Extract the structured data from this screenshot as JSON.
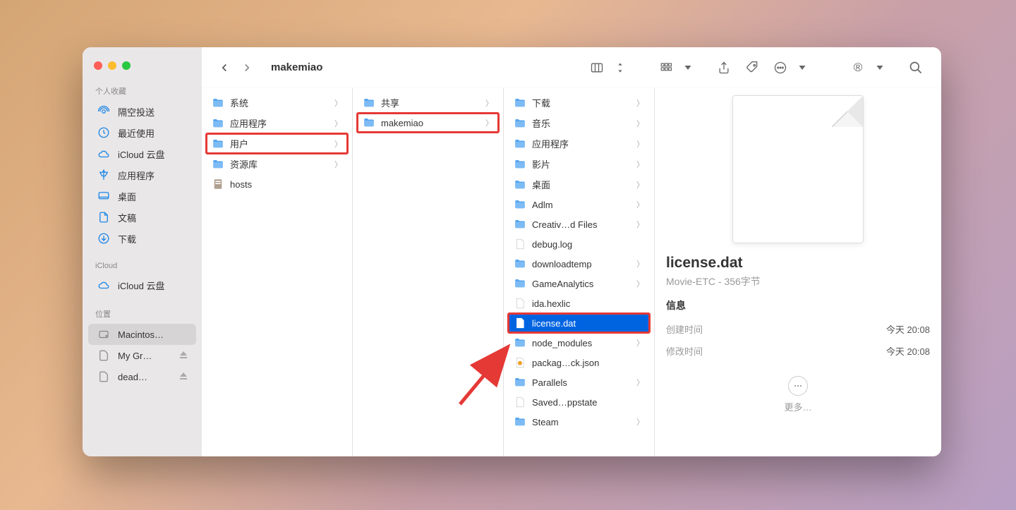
{
  "window": {
    "title": "makemiao"
  },
  "sidebar": {
    "section1_label": "个人收藏",
    "items1": [
      {
        "label": "隔空投送",
        "icon": "airdrop"
      },
      {
        "label": "最近使用",
        "icon": "clock"
      },
      {
        "label": "iCloud 云盘",
        "icon": "cloud"
      },
      {
        "label": "应用程序",
        "icon": "apps"
      },
      {
        "label": "桌面",
        "icon": "desktop"
      },
      {
        "label": "文稿",
        "icon": "doc"
      },
      {
        "label": "下载",
        "icon": "download"
      }
    ],
    "section2_label": "iCloud",
    "items2": [
      {
        "label": "iCloud 云盘",
        "icon": "cloud"
      }
    ],
    "section3_label": "位置",
    "items3": [
      {
        "label": "Macintos…",
        "icon": "disk",
        "selected": true
      },
      {
        "label": "My Gr…",
        "icon": "disk-ext",
        "eject": true
      },
      {
        "label": "dead…",
        "icon": "disk-ext",
        "eject": true
      }
    ]
  },
  "columns": {
    "c1": [
      {
        "label": "系统",
        "type": "folder",
        "chev": true
      },
      {
        "label": "应用程序",
        "type": "folder",
        "chev": true
      },
      {
        "label": "用户",
        "type": "folder",
        "chev": true,
        "highlight": true
      },
      {
        "label": "资源库",
        "type": "folder",
        "chev": true
      },
      {
        "label": "hosts",
        "type": "file-special"
      }
    ],
    "c2": [
      {
        "label": "共享",
        "type": "folder",
        "chev": true
      },
      {
        "label": "makemiao",
        "type": "folder-home",
        "chev": true,
        "highlight": true
      }
    ],
    "c3": [
      {
        "label": "下载",
        "type": "folder",
        "chev": true
      },
      {
        "label": "音乐",
        "type": "folder",
        "chev": true
      },
      {
        "label": "应用程序",
        "type": "folder",
        "chev": true
      },
      {
        "label": "影片",
        "type": "folder",
        "chev": true
      },
      {
        "label": "桌面",
        "type": "folder",
        "chev": true
      },
      {
        "label": "Adlm",
        "type": "folder",
        "chev": true
      },
      {
        "label": "Creativ…d Files",
        "type": "folder",
        "chev": true
      },
      {
        "label": "debug.log",
        "type": "file"
      },
      {
        "label": "downloadtemp",
        "type": "folder",
        "chev": true
      },
      {
        "label": "GameAnalytics",
        "type": "folder",
        "chev": true
      },
      {
        "label": "ida.hexlic",
        "type": "file"
      },
      {
        "label": "license.dat",
        "type": "file",
        "selected": true,
        "highlight": true
      },
      {
        "label": "node_modules",
        "type": "folder",
        "chev": true
      },
      {
        "label": "packag…ck.json",
        "type": "file-json"
      },
      {
        "label": "Parallels",
        "type": "folder",
        "chev": true
      },
      {
        "label": "Saved…ppstate",
        "type": "file"
      },
      {
        "label": "Steam",
        "type": "folder",
        "chev": true
      }
    ]
  },
  "preview": {
    "filename": "license.dat",
    "subtitle": "Movie-ETC - 356字节",
    "info_section": "信息",
    "rows": [
      {
        "label": "创建时间",
        "val": "今天 20:08"
      },
      {
        "label": "修改时间",
        "val": "今天 20:08"
      }
    ],
    "more_text": "更多…"
  },
  "toolbar": {
    "reg_badge": "®"
  }
}
